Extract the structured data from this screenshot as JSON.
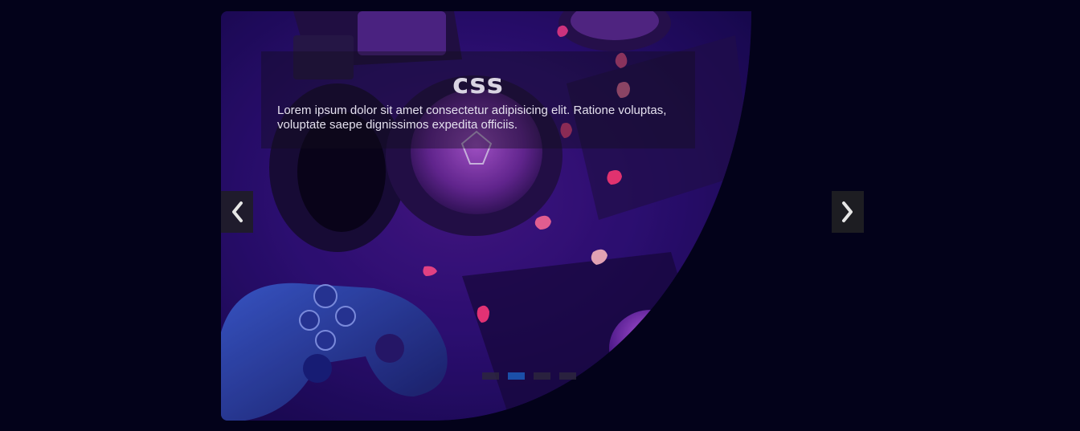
{
  "slider": {
    "caption": {
      "title": "css",
      "text": "Lorem ipsum dolor sit amet consectetur adipisicing elit. Ratione voluptas, voluptate saepe dignissimos expedita officiis."
    },
    "prev_icon": "chevron-left-icon",
    "next_icon": "chevron-right-icon",
    "dots": [
      {
        "active": false
      },
      {
        "active": true
      },
      {
        "active": false
      },
      {
        "active": false
      }
    ],
    "active_index": 1
  },
  "colors": {
    "page_background": "#03021a",
    "dot_active": "#1b4fa8",
    "dot_inactive": "#2d283c",
    "nav_button": "#1d1d22",
    "caption_text": "#e4e0ee"
  }
}
